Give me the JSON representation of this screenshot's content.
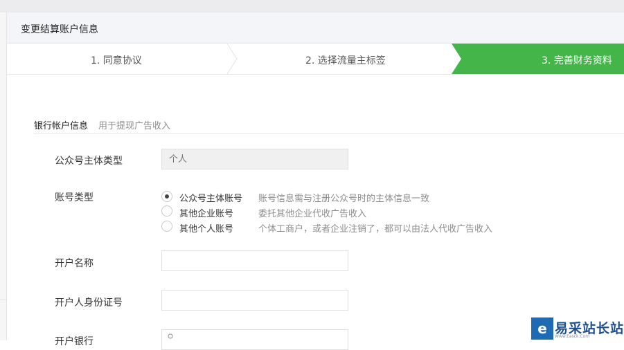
{
  "panel": {
    "title": "变更结算账户信息"
  },
  "steps": [
    {
      "label": "1. 同意协议",
      "active": false
    },
    {
      "label": "2. 选择流量主标签",
      "active": false
    },
    {
      "label": "3. 完善财务资料",
      "active": true
    }
  ],
  "colors": {
    "active_step": "#44b549",
    "header_bg": "#f4f5f9"
  },
  "section": {
    "title": "银行帐户信息",
    "subtitle": "用于提现广告收入"
  },
  "form": {
    "subject_type": {
      "label": "公众号主体类型",
      "placeholder": "个人"
    },
    "account_type": {
      "label": "账号类型",
      "options": [
        {
          "label": "公众号主体账号",
          "desc": "账号信息需与注册公众号时的主体信息一致",
          "checked": true
        },
        {
          "label": "其他企业账号",
          "desc": "委托其他企业代收广告收入",
          "checked": false
        },
        {
          "label": "其他个人账号",
          "desc": "个体工商户，或者企业注销了，都可以由法人代收广告收入",
          "checked": false
        }
      ]
    },
    "account_name": {
      "label": "开户名称",
      "value": ""
    },
    "id_number": {
      "label": "开户人身份证号",
      "value": ""
    },
    "bank": {
      "label": "开户银行",
      "value": ""
    }
  },
  "watermark": {
    "icon": "易采站长站-logo-icon",
    "text": "易采站长站",
    "sub": "Www.Easck.Com"
  }
}
